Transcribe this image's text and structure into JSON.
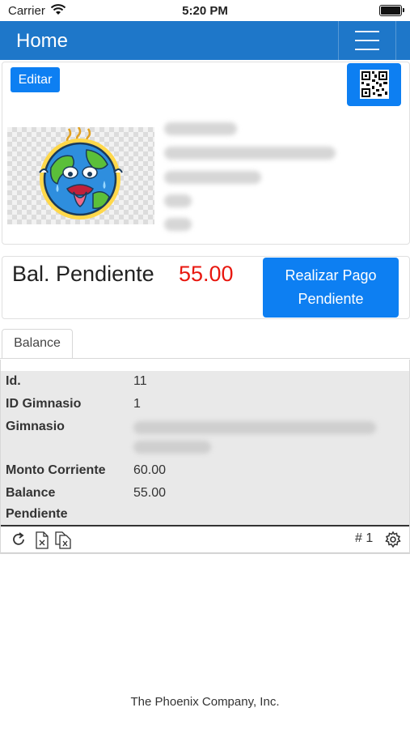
{
  "status_bar": {
    "carrier": "Carrier",
    "time": "5:20 PM"
  },
  "navbar": {
    "title": "Home"
  },
  "profile": {
    "edit_label": "Editar"
  },
  "balance": {
    "label": "Bal. Pendiente",
    "amount": "55.00",
    "pay_button": "Realizar Pago Pendiente",
    "amount_color": "#e8170f"
  },
  "tabs": [
    {
      "label": "Balance"
    }
  ],
  "grid": {
    "rows": [
      {
        "label": "Id.",
        "value": "11"
      },
      {
        "label": "ID Gimnasio",
        "value": "1"
      },
      {
        "label": "Gimnasio",
        "value": ""
      },
      {
        "label": "Monto Corriente",
        "value": "60.00"
      },
      {
        "label": "Balance Pendiente",
        "value": "55.00"
      }
    ],
    "toolbar": {
      "page": "# 1"
    }
  },
  "footer": {
    "text": "The Phoenix Company, Inc."
  },
  "colors": {
    "primary": "#0d7ff2",
    "navbar": "#1e77c9"
  },
  "icons": [
    "wifi-icon",
    "battery-icon",
    "hamburger-menu-icon",
    "qr-code-icon",
    "refresh-icon",
    "excel-export-icon",
    "copy-export-icon",
    "gear-icon"
  ]
}
